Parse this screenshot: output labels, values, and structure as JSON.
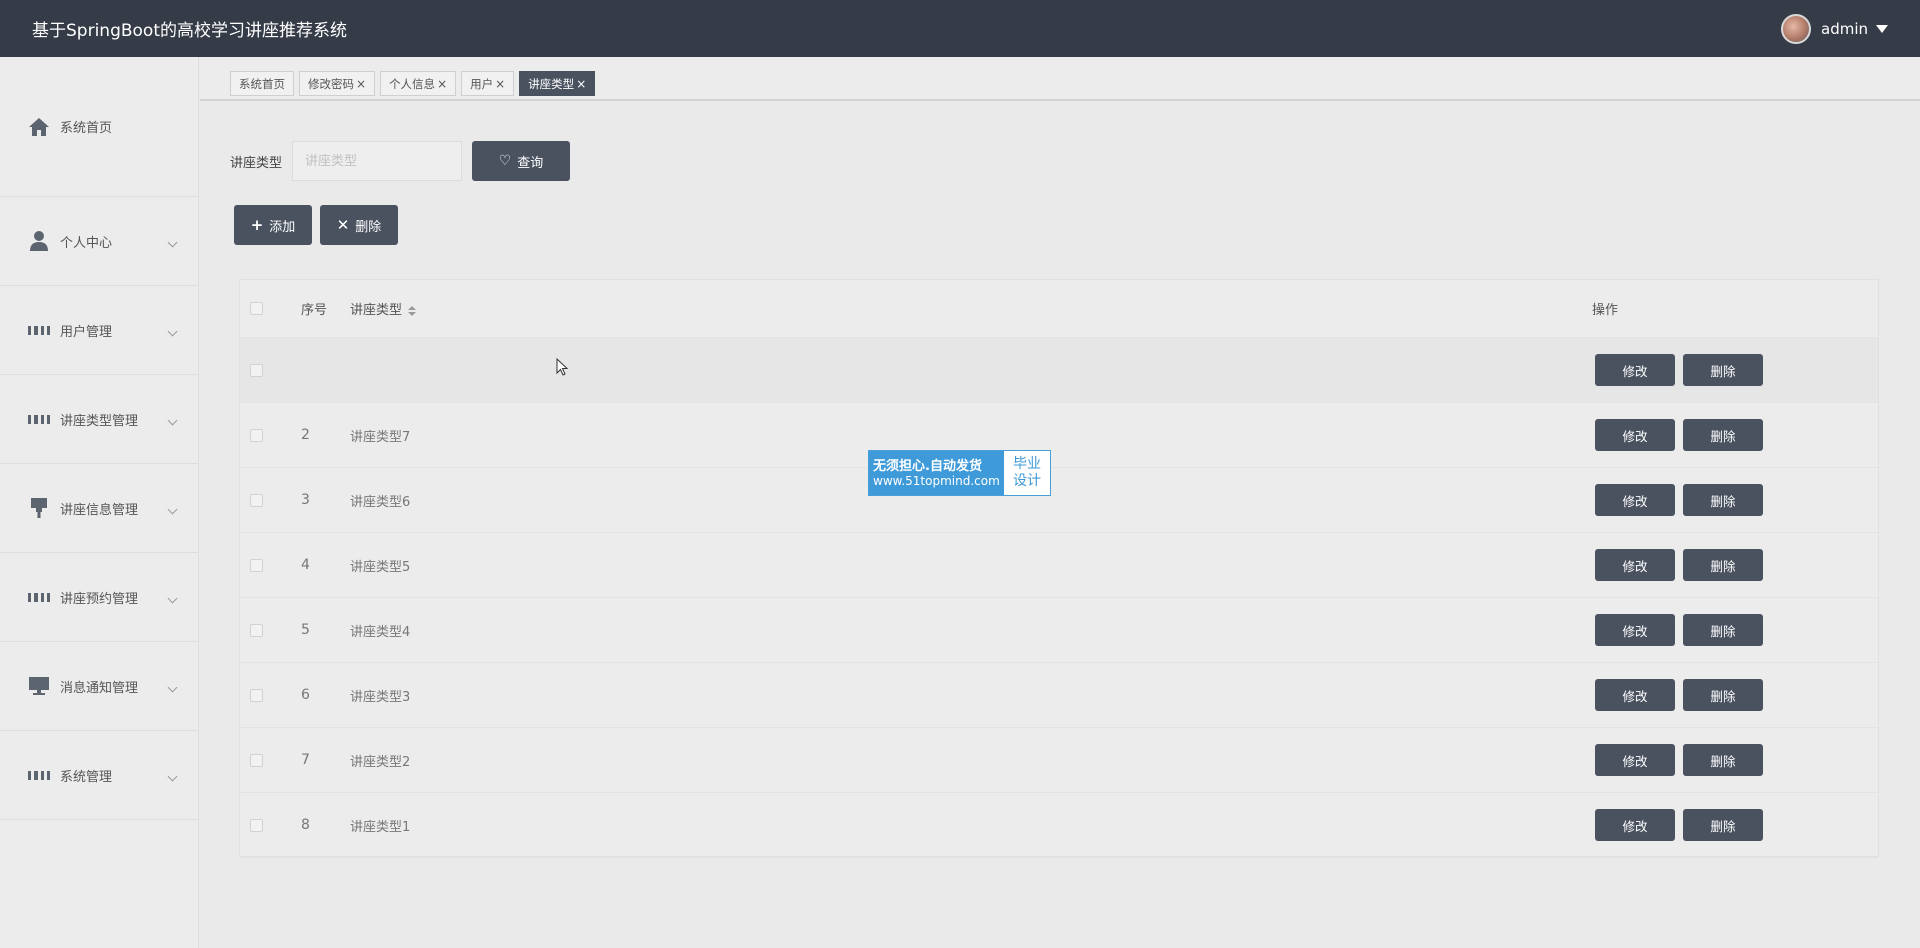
{
  "header": {
    "title": "基于SpringBoot的高校学习讲座推荐系统",
    "username": "admin"
  },
  "sidebar": {
    "items": [
      {
        "label": "系统首页",
        "icon": "home-icon",
        "has_children": false
      },
      {
        "label": "个人中心",
        "icon": "user-icon",
        "has_children": true
      },
      {
        "label": "用户管理",
        "icon": "grid-icon",
        "has_children": true
      },
      {
        "label": "讲座类型管理",
        "icon": "grid-icon",
        "has_children": true
      },
      {
        "label": "讲座信息管理",
        "icon": "brush-icon",
        "has_children": true
      },
      {
        "label": "讲座预约管理",
        "icon": "grid-icon",
        "has_children": true
      },
      {
        "label": "消息通知管理",
        "icon": "monitor-icon",
        "has_children": true
      },
      {
        "label": "系统管理",
        "icon": "grid-icon",
        "has_children": true
      }
    ]
  },
  "tabs": [
    {
      "label": "系统首页",
      "closable": false,
      "active": false
    },
    {
      "label": "修改密码",
      "closable": true,
      "active": false
    },
    {
      "label": "个人信息",
      "closable": true,
      "active": false
    },
    {
      "label": "用户",
      "closable": true,
      "active": false
    },
    {
      "label": "讲座类型",
      "closable": true,
      "active": true
    }
  ],
  "tab_close_glyph": "×",
  "search": {
    "label": "讲座类型",
    "placeholder": "讲座类型",
    "value": "",
    "button_label": "查询"
  },
  "actions": {
    "add_label": "添加",
    "delete_label": "删除"
  },
  "table": {
    "headers": {
      "index": "序号",
      "type": "讲座类型",
      "ops": "操作"
    },
    "edit_label": "修改",
    "delete_label": "删除",
    "rows": [
      {
        "index": "",
        "type": ""
      },
      {
        "index": "2",
        "type": "讲座类型7"
      },
      {
        "index": "3",
        "type": "讲座类型6"
      },
      {
        "index": "4",
        "type": "讲座类型5"
      },
      {
        "index": "5",
        "type": "讲座类型4"
      },
      {
        "index": "6",
        "type": "讲座类型3"
      },
      {
        "index": "7",
        "type": "讲座类型2"
      },
      {
        "index": "8",
        "type": "讲座类型1"
      }
    ]
  },
  "watermark": {
    "line1": "无须担心.自动发货",
    "line2": "www.51topmind.com",
    "right1": "毕业",
    "right2": "设计"
  },
  "colors": {
    "header_bg": "#353c47",
    "button_bg": "#4a5260",
    "page_bg": "#eaeaea",
    "watermark_blue": "#3e9ad8"
  }
}
